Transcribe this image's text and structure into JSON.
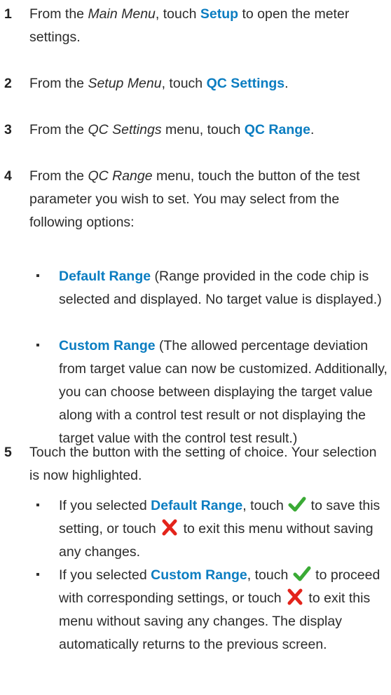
{
  "steps": [
    {
      "num": "1",
      "segments": [
        {
          "t": "From the "
        },
        {
          "t": "Main Menu",
          "s": "it"
        },
        {
          "t": ", touch "
        },
        {
          "t": "Setup",
          "s": "kw"
        },
        {
          "t": " to open the meter settings."
        }
      ]
    },
    {
      "num": "2",
      "segments": [
        {
          "t": "From the "
        },
        {
          "t": "Setup Menu",
          "s": "it"
        },
        {
          "t": ", touch "
        },
        {
          "t": "QC Settings",
          "s": "kw"
        },
        {
          "t": "."
        }
      ]
    },
    {
      "num": "3",
      "segments": [
        {
          "t": "From the "
        },
        {
          "t": "QC Settings",
          "s": "it"
        },
        {
          "t": " menu, touch "
        },
        {
          "t": "QC Range",
          "s": "kw"
        },
        {
          "t": "."
        }
      ]
    },
    {
      "num": "4",
      "segments": [
        {
          "t": "From the "
        },
        {
          "t": "QC Range",
          "s": "it"
        },
        {
          "t": " menu, touch the button of the test parameter you wish to set. You may select from the following options:"
        }
      ],
      "bullets": [
        [
          {
            "t": "Default Range",
            "s": "kw"
          },
          {
            "t": " (Range provided in the code chip is selected and displayed. No target value is displayed.)"
          }
        ],
        [
          {
            "t": "Custom Range",
            "s": "kw"
          },
          {
            "t": " (The allowed percentage deviation from target value can now be customized. Additionally, you can choose between displaying the target value along with a control test result or not displaying the target value with the control test result.)"
          }
        ]
      ]
    },
    {
      "num": "5",
      "segments": [
        {
          "t": "Touch the button with the setting of choice. Your selection is now highlighted."
        }
      ],
      "bullets": [
        [
          {
            "t": "If you selected "
          },
          {
            "t": "Default Range",
            "s": "kw"
          },
          {
            "t": ", touch "
          },
          {
            "icon": "checkmark-icon"
          },
          {
            "t": " to save this setting, or touch "
          },
          {
            "icon": "cross-icon"
          },
          {
            "t": " to exit this menu without saving any changes."
          }
        ],
        [
          {
            "t": "If you selected "
          },
          {
            "t": "Custom Range",
            "s": "kw"
          },
          {
            "t": ", touch "
          },
          {
            "icon": "checkmark-icon"
          },
          {
            "t": " to proceed with corresponding settings, or touch "
          },
          {
            "icon": "cross-icon"
          },
          {
            "t": " to exit this menu without saving any changes. The display automatically returns to the previous screen."
          }
        ]
      ]
    }
  ],
  "colors": {
    "keyword": "#0b7dc1",
    "check": "#3aaa35",
    "cross": "#e3241b"
  }
}
